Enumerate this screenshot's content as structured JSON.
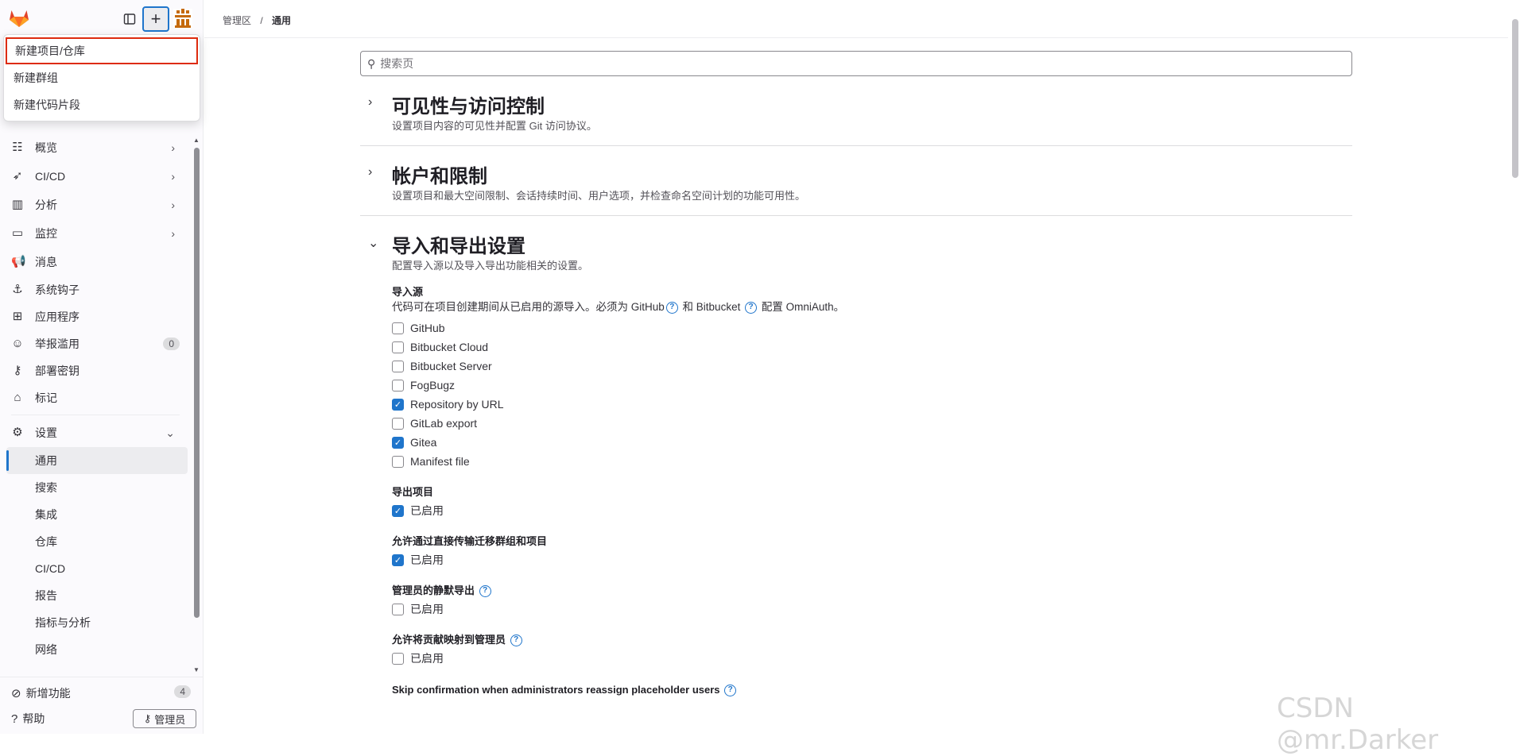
{
  "breadcrumb": {
    "root": "管理区",
    "separator": "/",
    "current": "通用"
  },
  "new_menu": {
    "items": [
      "新建项目/仓库",
      "新建群组",
      "新建代码片段"
    ]
  },
  "sidebar": {
    "items": [
      {
        "label": "概览",
        "icon": "overview-icon",
        "has_chevron": true
      },
      {
        "label": "CI/CD",
        "icon": "rocket-icon",
        "has_chevron": true
      },
      {
        "label": "分析",
        "icon": "chart-icon",
        "has_chevron": true
      },
      {
        "label": "监控",
        "icon": "monitor-icon",
        "has_chevron": true
      },
      {
        "label": "消息",
        "icon": "bullhorn-icon"
      },
      {
        "label": "系统钩子",
        "icon": "anchor-icon"
      },
      {
        "label": "应用程序",
        "icon": "apps-icon"
      },
      {
        "label": "举报滥用",
        "icon": "flag-icon",
        "count": "0"
      },
      {
        "label": "部署密钥",
        "icon": "key-icon"
      },
      {
        "label": "标记",
        "icon": "label-icon"
      }
    ],
    "settings": {
      "label": "设置",
      "icon": "gear-icon"
    },
    "settings_sub": [
      "通用",
      "搜索",
      "集成",
      "仓库",
      "CI/CD",
      "报告",
      "指标与分析",
      "网络"
    ],
    "footer": {
      "new_features": "新增功能",
      "new_features_count": "4",
      "help": "帮助",
      "admin": "管理员"
    }
  },
  "search": {
    "placeholder": "搜索页"
  },
  "sections": {
    "visibility": {
      "title": "可见性与访问控制",
      "desc": "设置项目内容的可见性并配置 Git 访问协议。"
    },
    "account": {
      "title": "帐户和限制",
      "desc": "设置项目和最大空间限制、会话持续时间、用户选项，并检查命名空间计划的功能可用性。"
    },
    "import_export": {
      "title": "导入和导出设置",
      "desc": "配置导入源以及导入导出功能相关的设置。",
      "import_sources": {
        "heading": "导入源",
        "desc_a": "代码可在项目创建期间从已启用的源导入。必须为 GitHub",
        "desc_b": "和 Bitbucket",
        "desc_c": "配置 OmniAuth。",
        "options": [
          {
            "label": "GitHub",
            "checked": false
          },
          {
            "label": "Bitbucket Cloud",
            "checked": false
          },
          {
            "label": "Bitbucket Server",
            "checked": false
          },
          {
            "label": "FogBugz",
            "checked": false
          },
          {
            "label": "Repository by URL",
            "checked": true
          },
          {
            "label": "GitLab export",
            "checked": false
          },
          {
            "label": "Gitea",
            "checked": true
          },
          {
            "label": "Manifest file",
            "checked": false
          }
        ]
      },
      "export_project": {
        "heading": "导出项目",
        "label": "已启用",
        "checked": true
      },
      "direct_transfer": {
        "heading": "允许通过直接传输迁移群组和项目",
        "label": "已启用",
        "checked": true
      },
      "silent_export": {
        "heading": "管理员的静默导出",
        "label": "已启用",
        "checked": false
      },
      "map_contributions": {
        "heading": "允许将贡献映射到管理员",
        "label": "已启用",
        "checked": false
      },
      "skip_confirmation": {
        "heading": "Skip confirmation when administrators reassign placeholder users"
      }
    }
  },
  "watermark": "CSDN @mr.Darker",
  "colors": {
    "accent": "#1f75cb",
    "highlight_border": "#dd2b0e"
  }
}
